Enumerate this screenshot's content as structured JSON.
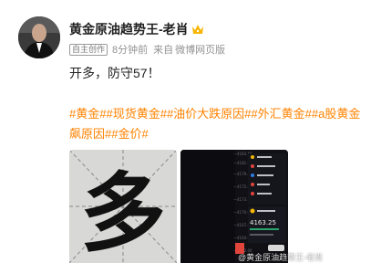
{
  "author": {
    "name": "黄金原油趋势王-老肖",
    "badge": "自主创作",
    "time": "8分钟前",
    "from_label": "来自",
    "source": "微博网页版"
  },
  "post": {
    "text": "开多，防守57！",
    "tags_line1": [
      "#黄金#",
      "#现货黄金#",
      "#油价大跌原因#",
      "#外汇黄金#",
      "#a股黄金"
    ],
    "tags_line2": [
      "飙原因#",
      "#金价#"
    ]
  },
  "images": {
    "first_alt": "多",
    "chart_price": "4163.25",
    "watermark": "@黄金原油趋势王-老肖"
  },
  "icons": {
    "crown": "crown-icon"
  }
}
